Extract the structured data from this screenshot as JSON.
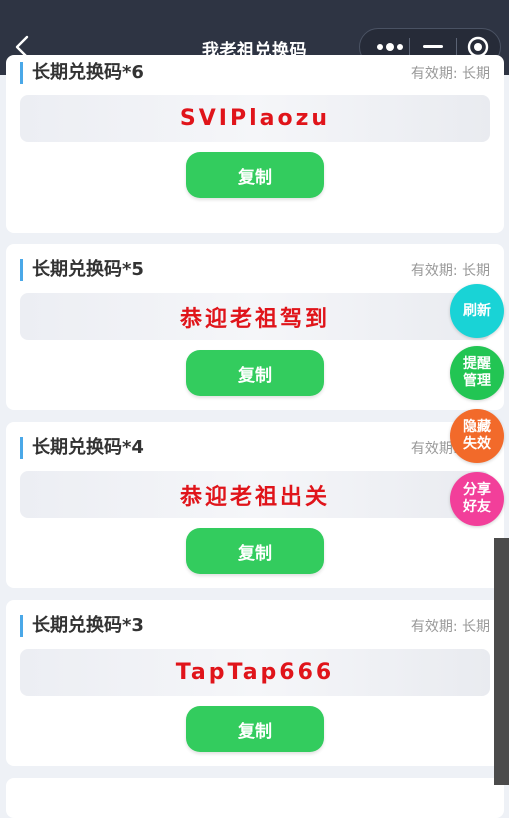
{
  "header": {
    "title": "我老祖兑换码",
    "back_icon": "back-arrow-icon",
    "capsule_icons": [
      "more-dots-icon",
      "minimize-icon",
      "close-circle-icon"
    ]
  },
  "cards": [
    {
      "title": "长期兑换码*6",
      "validity": "有效期: 长期",
      "code": "SVIPlaozu",
      "copy_label": "复制"
    },
    {
      "title": "长期兑换码*5",
      "validity": "有效期: 长期",
      "code": "恭迎老祖驾到",
      "copy_label": "复制"
    },
    {
      "title": "长期兑换码*4",
      "validity": "有效期: 长期",
      "code": "恭迎老祖出关",
      "copy_label": "复制"
    },
    {
      "title": "长期兑换码*3",
      "validity": "有效期: 长期",
      "code": "TapTap666",
      "copy_label": "复制"
    }
  ],
  "floating": {
    "refresh": {
      "label": "刷新",
      "color": "#19d3d6"
    },
    "remind": {
      "label": "提醒管理",
      "color": "#22c553"
    },
    "hide": {
      "label": "隐藏失效",
      "color": "#f26a2a"
    },
    "share": {
      "label": "分享好友",
      "color": "#f23f9a"
    }
  },
  "colors": {
    "header_bg": "#2e3443",
    "code_text": "#e0141a",
    "copy_button": "#33cc5e",
    "title_accent": "#4aa8e8"
  }
}
